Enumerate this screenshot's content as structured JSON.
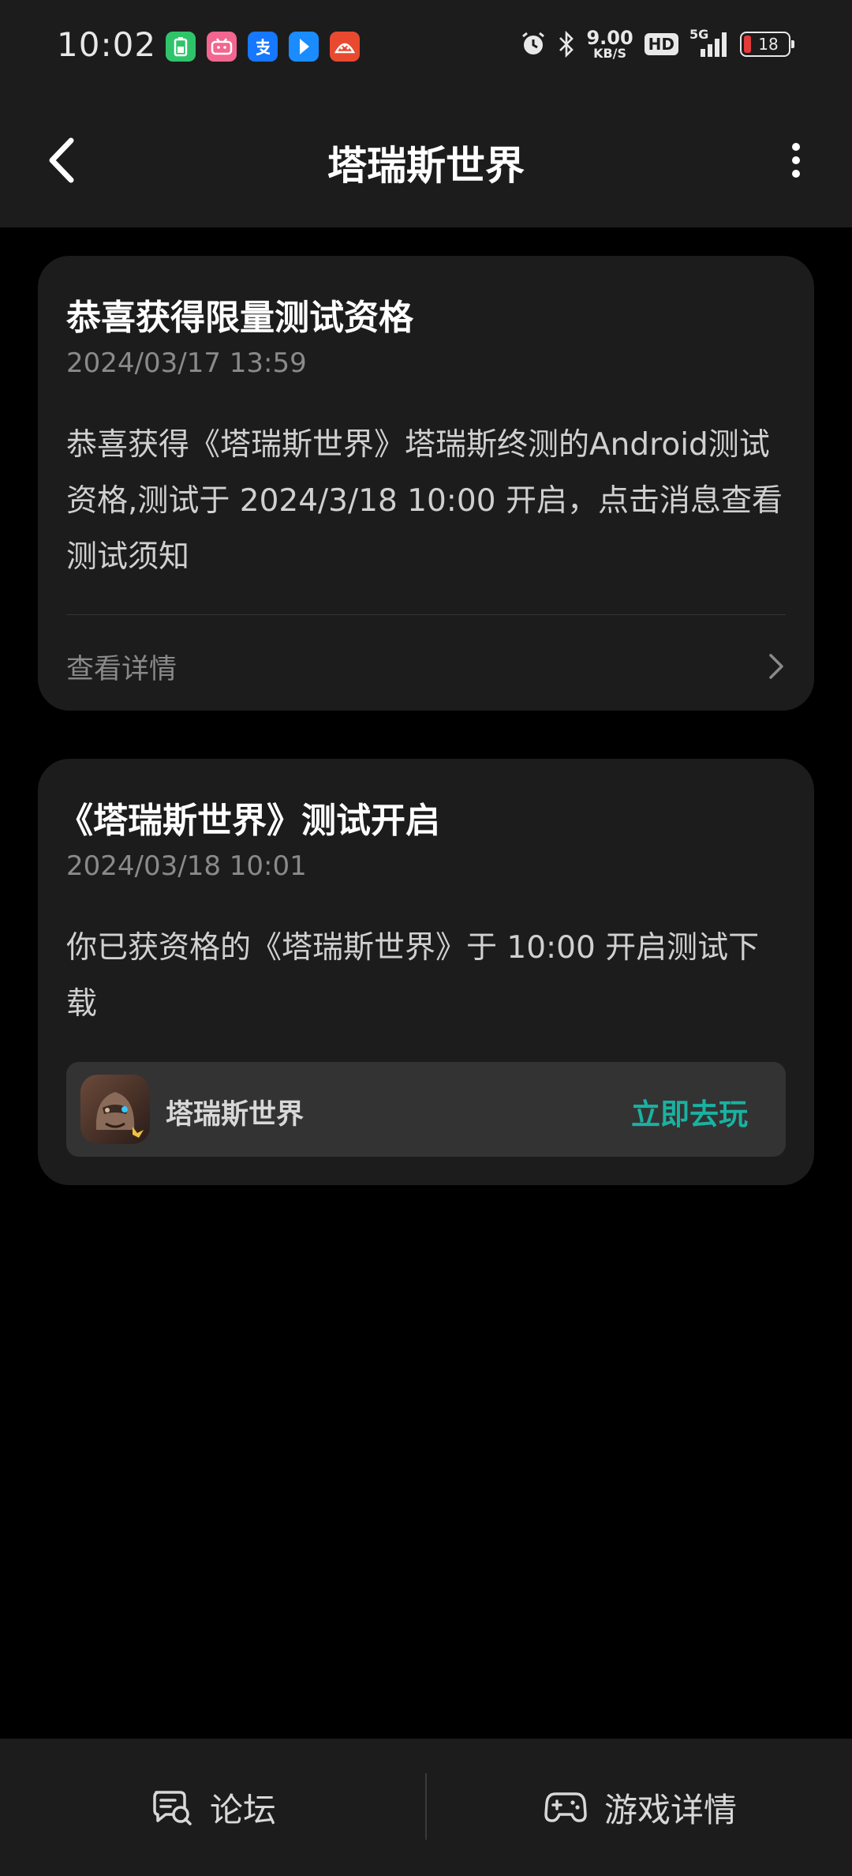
{
  "status_bar": {
    "time": "10:02",
    "network_speed_value": "9.00",
    "network_speed_unit": "KB/S",
    "hd_label": "HD",
    "signal_label": "5G",
    "battery_level": "18",
    "notif_icons": [
      "battery-app-icon",
      "bilibili-icon",
      "alipay-icon",
      "direction-app-icon",
      "red-app-icon"
    ]
  },
  "header": {
    "title": "塔瑞斯世界"
  },
  "cards": [
    {
      "title": "恭喜获得限量测试资格",
      "date": "2024/03/17 13:59",
      "body": "恭喜获得《塔瑞斯世界》塔瑞斯终测的Android测试资格,测试于 2024/3/18 10:00 开启，点击消息查看测试须知",
      "detail_label": "查看详情"
    },
    {
      "title": "《塔瑞斯世界》测试开启",
      "date": "2024/03/18 10:01",
      "body": "你已获资格的《塔瑞斯世界》于 10:00 开启测试下载",
      "game_name": "塔瑞斯世界",
      "play_label": "立即去玩"
    }
  ],
  "bottom_bar": {
    "forum_label": "论坛",
    "game_detail_label": "游戏详情"
  },
  "colors": {
    "background": "#000000",
    "surface": "#1c1c1c",
    "accent": "#19b2a1",
    "muted_text": "#8a8a8a"
  }
}
